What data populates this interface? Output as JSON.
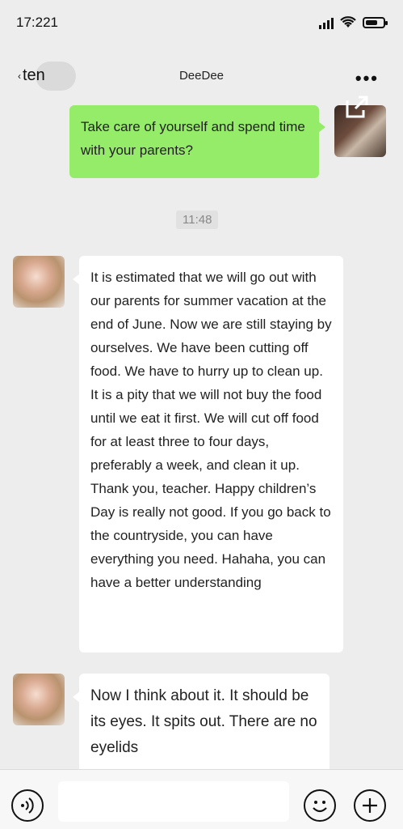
{
  "status": {
    "time": "17:221"
  },
  "nav": {
    "back_label": "ten",
    "title": "DeeDee"
  },
  "messages": [
    {
      "from": "me",
      "text": "Take care of yourself and spend time with your parents?"
    },
    {
      "from": "other",
      "text": "It is estimated that we will go out with our parents for summer vacation at the end of June. Now we are still staying by ourselves. We have been cutting off food. We have to hurry up to clean up. It is a pity that we will not buy the food until we eat it first. We will cut off food for at least three to four days, preferably a week, and clean it up. Thank you, teacher. Happy children’s Day is really not good. If you go back to the countryside, you can have everything you need. Hahaha, you can have a better understanding"
    },
    {
      "from": "other",
      "text": "Now I think about it. It should be its eyes. It spits out. There are no eyelids"
    }
  ],
  "timestamp": "11:48",
  "icons": {
    "back": "chevron-left-icon",
    "more": "more-dots-icon",
    "share": "share-icon",
    "voice": "voice-icon",
    "emoji": "emoji-icon",
    "plus": "plus-icon"
  },
  "colors": {
    "my_bubble": "#95ec69",
    "other_bubble": "#ffffff",
    "background": "#ededed"
  }
}
